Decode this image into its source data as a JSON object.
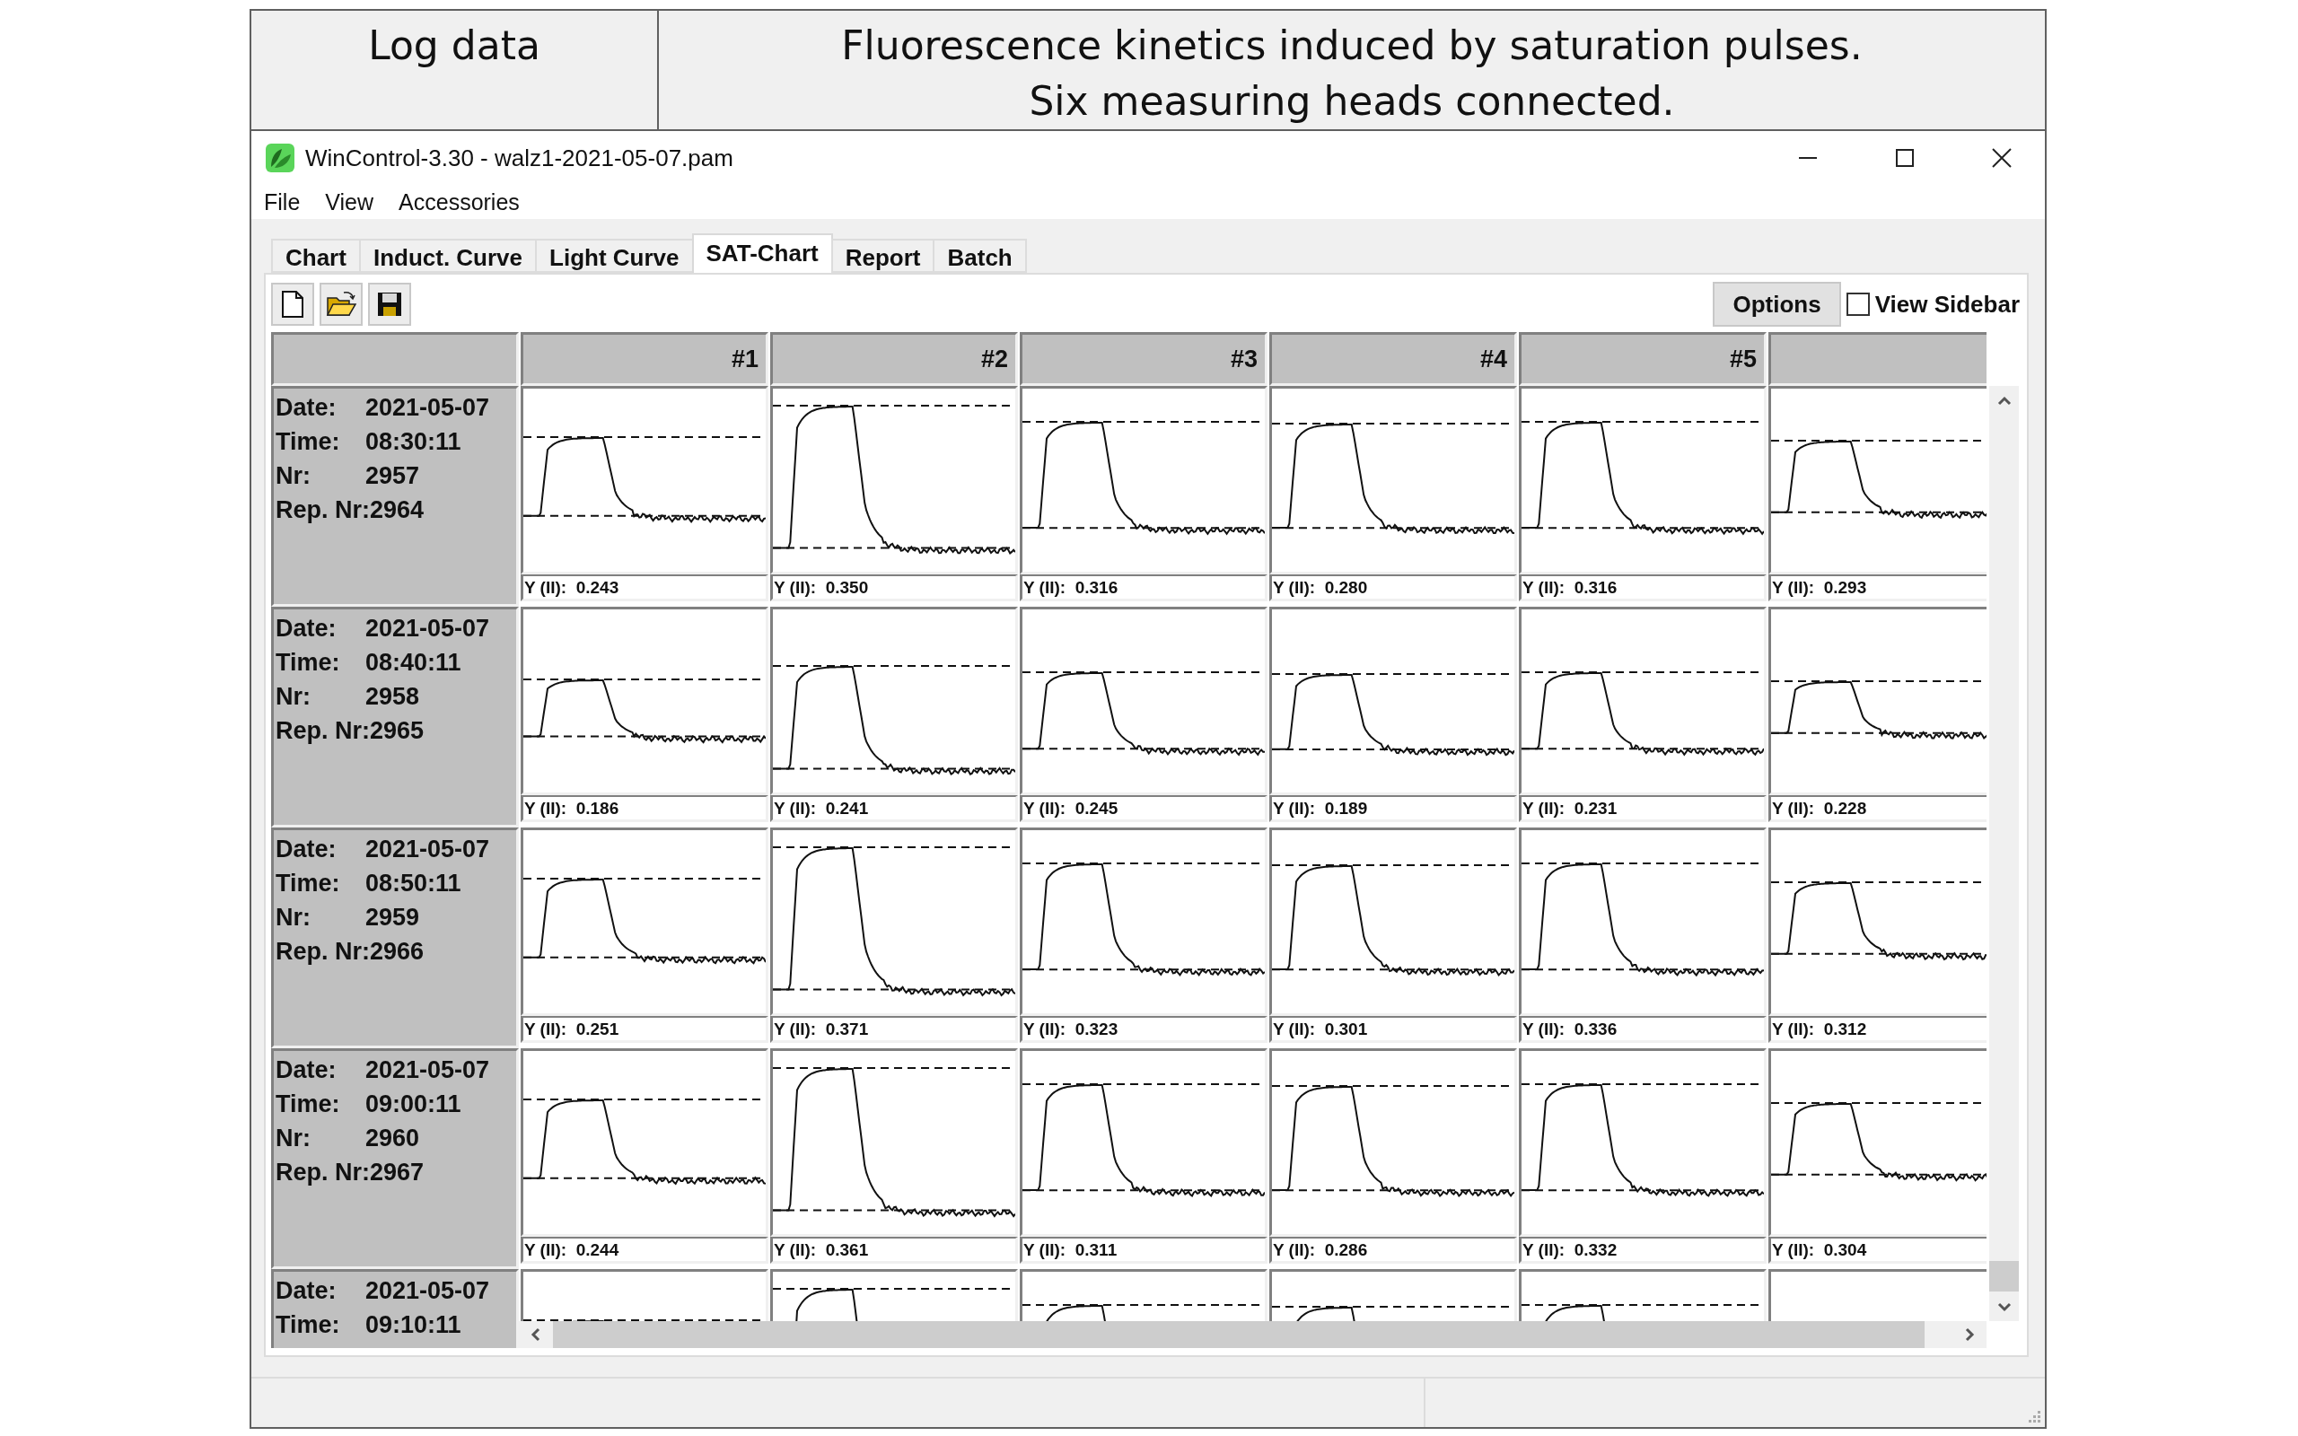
{
  "figure_header": {
    "left": "Log data",
    "right_lines": [
      "Fluorescence kinetics induced by saturation pulses.",
      "Six measuring heads connected."
    ]
  },
  "window": {
    "title": "WinControl-3.30 - walz1-2021-05-07.pam"
  },
  "menu": [
    "File",
    "View",
    "Accessories"
  ],
  "tabs": [
    {
      "label": "Chart",
      "selected": false
    },
    {
      "label": "Induct. Curve",
      "selected": false
    },
    {
      "label": "Light Curve",
      "selected": false
    },
    {
      "label": "SAT-Chart",
      "selected": true
    },
    {
      "label": "Report",
      "selected": false
    },
    {
      "label": "Batch",
      "selected": false
    }
  ],
  "toolbar": {
    "options": "Options",
    "view_sidebar": {
      "label": "View Sidebar",
      "checked": false
    }
  },
  "columns": [
    "#1",
    "#2",
    "#3",
    "#4",
    "#5"
  ],
  "rows": [
    {
      "partial": false,
      "fields": [
        {
          "label": "Date:",
          "value": "2021-05-07"
        },
        {
          "label": "Time:",
          "value": "08:30:11"
        },
        {
          "label": "Nr:",
          "value": "2957"
        },
        {
          "label": "Rep. Nr:",
          "value": "2964"
        }
      ],
      "cells": [
        {
          "label": "Y (II):",
          "value": "0.243"
        },
        {
          "label": "Y (II):",
          "value": "0.350"
        },
        {
          "label": "Y (II):",
          "value": "0.316"
        },
        {
          "label": "Y (II):",
          "value": "0.280"
        },
        {
          "label": "Y (II):",
          "value": "0.316"
        },
        {
          "label": "Y (II):",
          "value": "0.293"
        }
      ]
    },
    {
      "partial": false,
      "fields": [
        {
          "label": "Date:",
          "value": "2021-05-07"
        },
        {
          "label": "Time:",
          "value": "08:40:11"
        },
        {
          "label": "Nr:",
          "value": "2958"
        },
        {
          "label": "Rep. Nr:",
          "value": "2965"
        }
      ],
      "cells": [
        {
          "label": "Y (II):",
          "value": "0.186"
        },
        {
          "label": "Y (II):",
          "value": "0.241"
        },
        {
          "label": "Y (II):",
          "value": "0.245"
        },
        {
          "label": "Y (II):",
          "value": "0.189"
        },
        {
          "label": "Y (II):",
          "value": "0.231"
        },
        {
          "label": "Y (II):",
          "value": "0.228"
        }
      ]
    },
    {
      "partial": false,
      "fields": [
        {
          "label": "Date:",
          "value": "2021-05-07"
        },
        {
          "label": "Time:",
          "value": "08:50:11"
        },
        {
          "label": "Nr:",
          "value": "2959"
        },
        {
          "label": "Rep. Nr:",
          "value": "2966"
        }
      ],
      "cells": [
        {
          "label": "Y (II):",
          "value": "0.251"
        },
        {
          "label": "Y (II):",
          "value": "0.371"
        },
        {
          "label": "Y (II):",
          "value": "0.323"
        },
        {
          "label": "Y (II):",
          "value": "0.301"
        },
        {
          "label": "Y (II):",
          "value": "0.336"
        },
        {
          "label": "Y (II):",
          "value": "0.312"
        }
      ]
    },
    {
      "partial": false,
      "fields": [
        {
          "label": "Date:",
          "value": "2021-05-07"
        },
        {
          "label": "Time:",
          "value": "09:00:11"
        },
        {
          "label": "Nr:",
          "value": "2960"
        },
        {
          "label": "Rep. Nr:",
          "value": "2967"
        }
      ],
      "cells": [
        {
          "label": "Y (II):",
          "value": "0.244"
        },
        {
          "label": "Y (II):",
          "value": "0.361"
        },
        {
          "label": "Y (II):",
          "value": "0.311"
        },
        {
          "label": "Y (II):",
          "value": "0.286"
        },
        {
          "label": "Y (II):",
          "value": "0.332"
        },
        {
          "label": "Y (II):",
          "value": "0.304"
        }
      ]
    },
    {
      "partial": true,
      "fields": [
        {
          "label": "Date:",
          "value": "2021-05-07"
        },
        {
          "label": "Time:",
          "value": "09:10:11"
        }
      ]
    }
  ]
}
